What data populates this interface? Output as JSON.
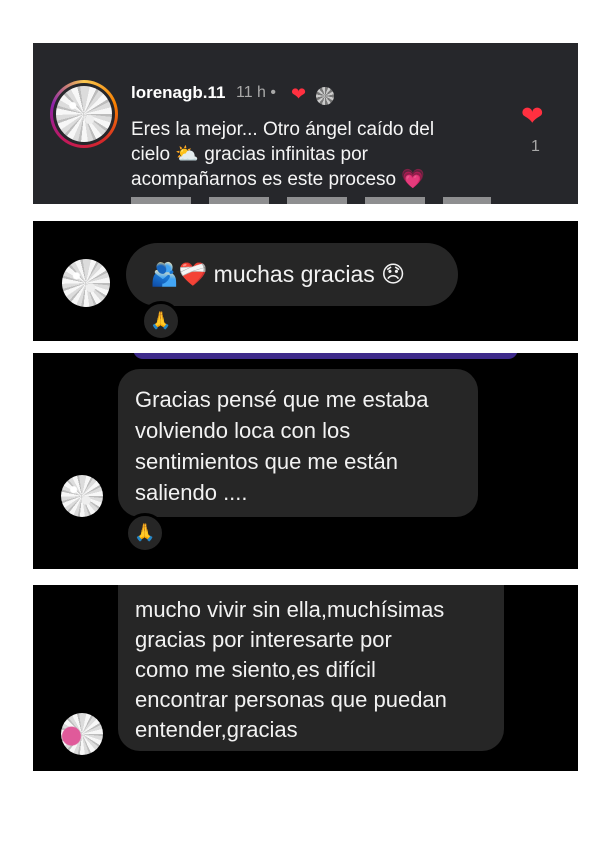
{
  "panel1": {
    "username": "lorenagb.11",
    "time": "11 h •",
    "comment": "Eres la mejor... Otro ángel caído del\ncielo ⛅ gracias infinitas por\nacompañarnos es este proceso 💗",
    "like_icon": "heart-icon",
    "like_count": "1",
    "colors": {
      "like": "#ff3040",
      "background": "#26272b"
    }
  },
  "panel2": {
    "message": "🫂❤️‍🩹 muchas gracias 😞",
    "reaction": "🙏"
  },
  "panel3": {
    "message": "Gracias pensé que me estaba\nvolviendo loca con los\nsentimientos que me están\nsaliendo ....",
    "reaction": "🙏"
  },
  "panel4": {
    "message": "mucho vivir sin ella,muchísimas\ngracias por interesarte por\ncomo me siento,es difícil\nencontrar personas que puedan\nentender,gracias"
  }
}
